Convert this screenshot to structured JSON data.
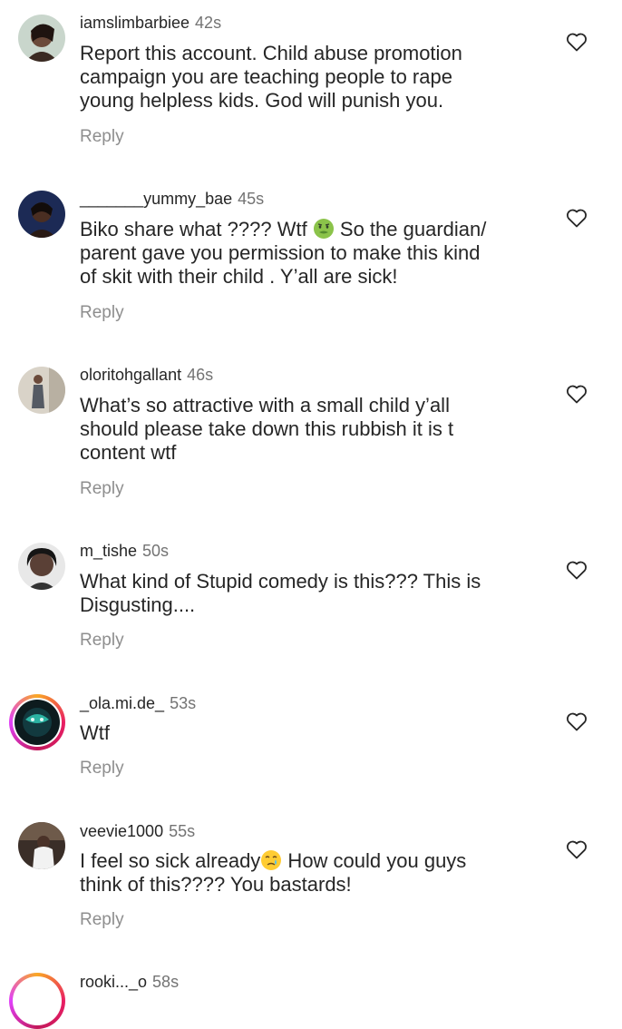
{
  "comments": [
    {
      "username": "iamslimbarbiee",
      "time": "42s",
      "lines": [
        "Report this account. Child abuse promotion",
        "campaign you are teaching people to rape",
        "young helpless kids. God will punish you."
      ],
      "reply": "Reply"
    },
    {
      "username": "_______yummy_bae",
      "time": "45s",
      "line1_before": "Biko share what ???? Wtf ",
      "line1_after": " So the guardian/",
      "lines_rest": [
        "parent gave you permission to make this kind",
        "of skit with their child . Y’all are sick!"
      ],
      "reply": "Reply"
    },
    {
      "username": "oloritohgallant",
      "time": "46s",
      "lines": [
        "What’s so attractive with a small child y’all",
        "should please take down this rubbish it is t",
        "content wtf"
      ],
      "reply": "Reply"
    },
    {
      "username": "m_tishe",
      "time": "50s",
      "lines": [
        "What kind of Stupid comedy is this??? This is",
        "Disgusting...."
      ],
      "reply": "Reply"
    },
    {
      "username": "_ola.mi.de_",
      "time": "53s",
      "lines": [
        "Wtf"
      ],
      "reply": "Reply"
    },
    {
      "username": "veevie1000",
      "time": "55s",
      "line1_before": "I feel so sick already",
      "line1_after": " How could you guys",
      "lines_rest": [
        "think of this???? You bastards!"
      ],
      "reply": "Reply"
    },
    {
      "username": "rooki..._o",
      "time": "58s"
    }
  ],
  "icons": {
    "heart": "heart-outline-icon",
    "emoji_sick": "nauseated-face-emoji",
    "emoji_cry": "crying-face-emoji"
  },
  "colors": {
    "text": "#262626",
    "meta": "#737373",
    "reply": "#8e8e8e",
    "story_ring": "#e91e63"
  }
}
